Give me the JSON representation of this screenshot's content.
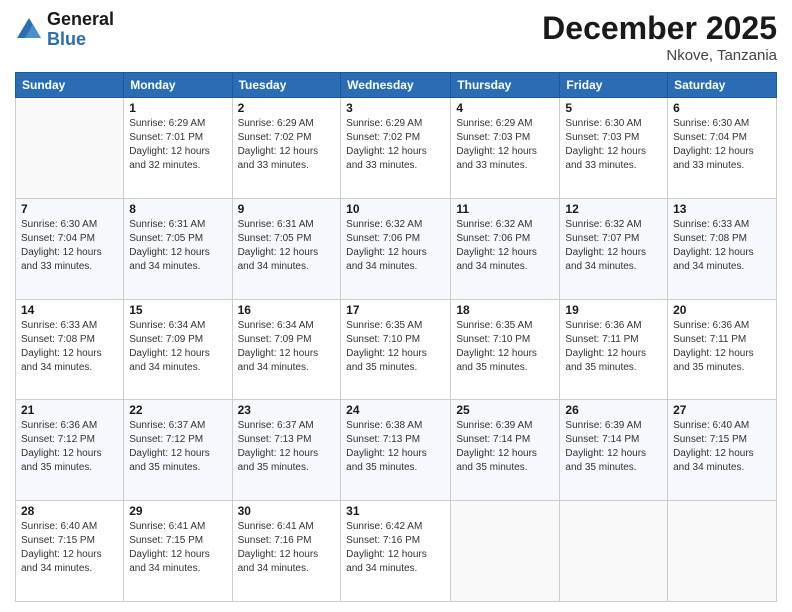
{
  "header": {
    "logo_general": "General",
    "logo_blue": "Blue",
    "month_title": "December 2025",
    "location": "Nkove, Tanzania"
  },
  "weekdays": [
    "Sunday",
    "Monday",
    "Tuesday",
    "Wednesday",
    "Thursday",
    "Friday",
    "Saturday"
  ],
  "weeks": [
    [
      {
        "day": "",
        "info": ""
      },
      {
        "day": "1",
        "info": "Sunrise: 6:29 AM\nSunset: 7:01 PM\nDaylight: 12 hours\nand 32 minutes."
      },
      {
        "day": "2",
        "info": "Sunrise: 6:29 AM\nSunset: 7:02 PM\nDaylight: 12 hours\nand 33 minutes."
      },
      {
        "day": "3",
        "info": "Sunrise: 6:29 AM\nSunset: 7:02 PM\nDaylight: 12 hours\nand 33 minutes."
      },
      {
        "day": "4",
        "info": "Sunrise: 6:29 AM\nSunset: 7:03 PM\nDaylight: 12 hours\nand 33 minutes."
      },
      {
        "day": "5",
        "info": "Sunrise: 6:30 AM\nSunset: 7:03 PM\nDaylight: 12 hours\nand 33 minutes."
      },
      {
        "day": "6",
        "info": "Sunrise: 6:30 AM\nSunset: 7:04 PM\nDaylight: 12 hours\nand 33 minutes."
      }
    ],
    [
      {
        "day": "7",
        "info": "Sunrise: 6:30 AM\nSunset: 7:04 PM\nDaylight: 12 hours\nand 33 minutes."
      },
      {
        "day": "8",
        "info": "Sunrise: 6:31 AM\nSunset: 7:05 PM\nDaylight: 12 hours\nand 34 minutes."
      },
      {
        "day": "9",
        "info": "Sunrise: 6:31 AM\nSunset: 7:05 PM\nDaylight: 12 hours\nand 34 minutes."
      },
      {
        "day": "10",
        "info": "Sunrise: 6:32 AM\nSunset: 7:06 PM\nDaylight: 12 hours\nand 34 minutes."
      },
      {
        "day": "11",
        "info": "Sunrise: 6:32 AM\nSunset: 7:06 PM\nDaylight: 12 hours\nand 34 minutes."
      },
      {
        "day": "12",
        "info": "Sunrise: 6:32 AM\nSunset: 7:07 PM\nDaylight: 12 hours\nand 34 minutes."
      },
      {
        "day": "13",
        "info": "Sunrise: 6:33 AM\nSunset: 7:08 PM\nDaylight: 12 hours\nand 34 minutes."
      }
    ],
    [
      {
        "day": "14",
        "info": "Sunrise: 6:33 AM\nSunset: 7:08 PM\nDaylight: 12 hours\nand 34 minutes."
      },
      {
        "day": "15",
        "info": "Sunrise: 6:34 AM\nSunset: 7:09 PM\nDaylight: 12 hours\nand 34 minutes."
      },
      {
        "day": "16",
        "info": "Sunrise: 6:34 AM\nSunset: 7:09 PM\nDaylight: 12 hours\nand 34 minutes."
      },
      {
        "day": "17",
        "info": "Sunrise: 6:35 AM\nSunset: 7:10 PM\nDaylight: 12 hours\nand 35 minutes."
      },
      {
        "day": "18",
        "info": "Sunrise: 6:35 AM\nSunset: 7:10 PM\nDaylight: 12 hours\nand 35 minutes."
      },
      {
        "day": "19",
        "info": "Sunrise: 6:36 AM\nSunset: 7:11 PM\nDaylight: 12 hours\nand 35 minutes."
      },
      {
        "day": "20",
        "info": "Sunrise: 6:36 AM\nSunset: 7:11 PM\nDaylight: 12 hours\nand 35 minutes."
      }
    ],
    [
      {
        "day": "21",
        "info": "Sunrise: 6:36 AM\nSunset: 7:12 PM\nDaylight: 12 hours\nand 35 minutes."
      },
      {
        "day": "22",
        "info": "Sunrise: 6:37 AM\nSunset: 7:12 PM\nDaylight: 12 hours\nand 35 minutes."
      },
      {
        "day": "23",
        "info": "Sunrise: 6:37 AM\nSunset: 7:13 PM\nDaylight: 12 hours\nand 35 minutes."
      },
      {
        "day": "24",
        "info": "Sunrise: 6:38 AM\nSunset: 7:13 PM\nDaylight: 12 hours\nand 35 minutes."
      },
      {
        "day": "25",
        "info": "Sunrise: 6:39 AM\nSunset: 7:14 PM\nDaylight: 12 hours\nand 35 minutes."
      },
      {
        "day": "26",
        "info": "Sunrise: 6:39 AM\nSunset: 7:14 PM\nDaylight: 12 hours\nand 35 minutes."
      },
      {
        "day": "27",
        "info": "Sunrise: 6:40 AM\nSunset: 7:15 PM\nDaylight: 12 hours\nand 34 minutes."
      }
    ],
    [
      {
        "day": "28",
        "info": "Sunrise: 6:40 AM\nSunset: 7:15 PM\nDaylight: 12 hours\nand 34 minutes."
      },
      {
        "day": "29",
        "info": "Sunrise: 6:41 AM\nSunset: 7:15 PM\nDaylight: 12 hours\nand 34 minutes."
      },
      {
        "day": "30",
        "info": "Sunrise: 6:41 AM\nSunset: 7:16 PM\nDaylight: 12 hours\nand 34 minutes."
      },
      {
        "day": "31",
        "info": "Sunrise: 6:42 AM\nSunset: 7:16 PM\nDaylight: 12 hours\nand 34 minutes."
      },
      {
        "day": "",
        "info": ""
      },
      {
        "day": "",
        "info": ""
      },
      {
        "day": "",
        "info": ""
      }
    ]
  ]
}
